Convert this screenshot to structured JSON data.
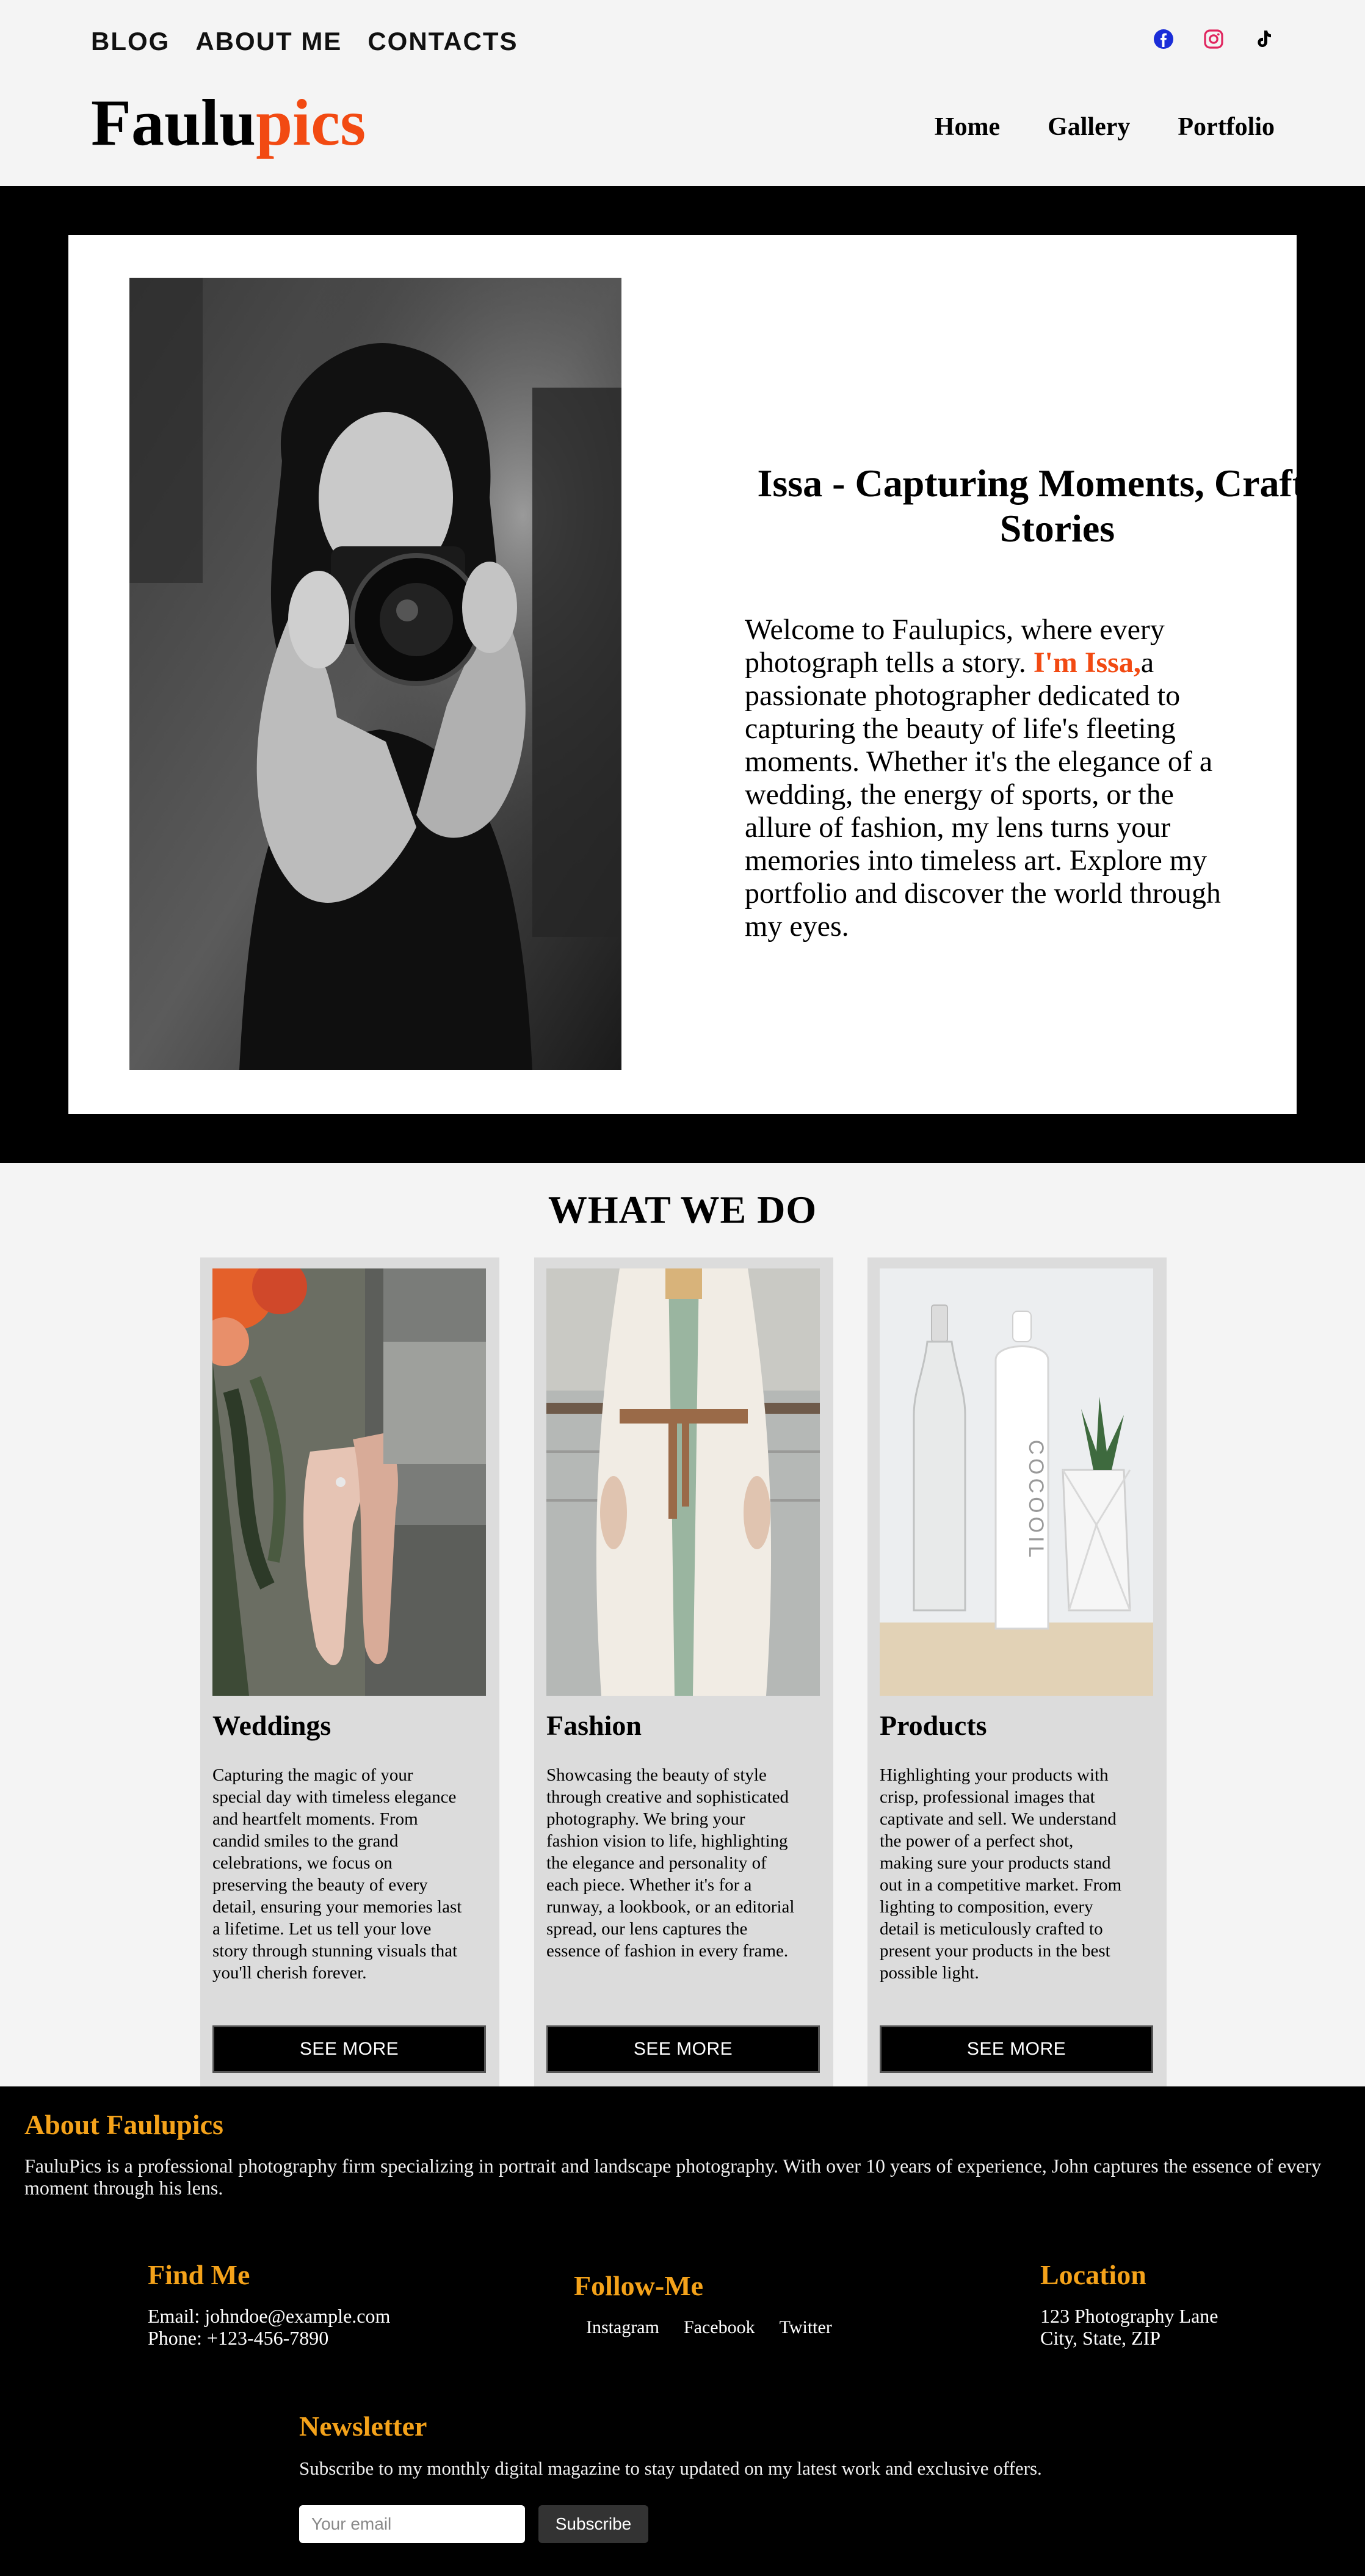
{
  "header": {
    "top_links": [
      "BLOG",
      "ABOUT ME",
      "CONTACTS"
    ],
    "social_icons": [
      "facebook-icon",
      "instagram-icon",
      "tiktok-icon"
    ],
    "logo_main": "Faulu",
    "logo_accent": "pics",
    "nav": [
      "Home",
      "Gallery",
      "Portfolio"
    ]
  },
  "hero": {
    "title": "Issa - Capturing Moments, Crafting Stories",
    "text_before": "Welcome to Faulupics, where every photograph tells a story. ",
    "highlight": "I'm Issa,",
    "text_after": "a passionate photographer dedicated to capturing the beauty of life's fleeting moments. Whether it's the elegance of a wedding, the energy of sports, or the allure of fashion, my lens turns your memories into timeless art. Explore my portfolio and discover the world through my eyes."
  },
  "services": {
    "title": "WHAT WE DO",
    "cards": [
      {
        "title": "Weddings",
        "desc": "Capturing the magic of your special day with timeless elegance and heartfelt moments. From candid smiles to the grand celebrations, we focus on preserving the beauty of every detail, ensuring your memories last a lifetime. Let us tell your love story through stunning visuals that you'll cherish forever.",
        "button": "SEE MORE"
      },
      {
        "title": "Fashion",
        "desc": "Showcasing the beauty of style through creative and sophisticated photography. We bring your fashion vision to life, highlighting the elegance and personality of each piece. Whether it's for a runway, a lookbook, or an editorial spread, our lens captures the essence of fashion in every frame.",
        "button": "SEE MORE"
      },
      {
        "title": "Products",
        "desc": "Highlighting your products with crisp, professional images that captivate and sell. We understand the power of a perfect shot, making sure your products stand out in a competitive market. From lighting to composition, every detail is meticulously crafted to present your products in the best possible light.",
        "button": "SEE MORE"
      }
    ]
  },
  "footer": {
    "about_title": "About Faulupics",
    "about_text": "FauluPics is a professional photography firm specializing in portrait and landscape photography. With over 10 years of experience, John captures the essence of every moment through his lens.",
    "find_title": "Find Me",
    "email": "Email: johndoe@example.com",
    "phone": "Phone: +123-456-7890",
    "follow_title": "Follow-Me",
    "follow_links": [
      "Instagram",
      "Facebook",
      "Twitter"
    ],
    "location_title": "Location",
    "address_line1": "123 Photography Lane",
    "address_line2": "City, State, ZIP",
    "newsletter_title": "Newsletter",
    "newsletter_text": "Subscribe to my monthly digital magazine to stay updated on my latest work and exclusive offers.",
    "email_placeholder": "Your email",
    "subscribe_label": "Subscribe"
  },
  "colors": {
    "accent": "#f24a12",
    "footer_heading": "#f4a21a",
    "facebook": "#1a2dd8",
    "instagram": "#e0245e"
  }
}
